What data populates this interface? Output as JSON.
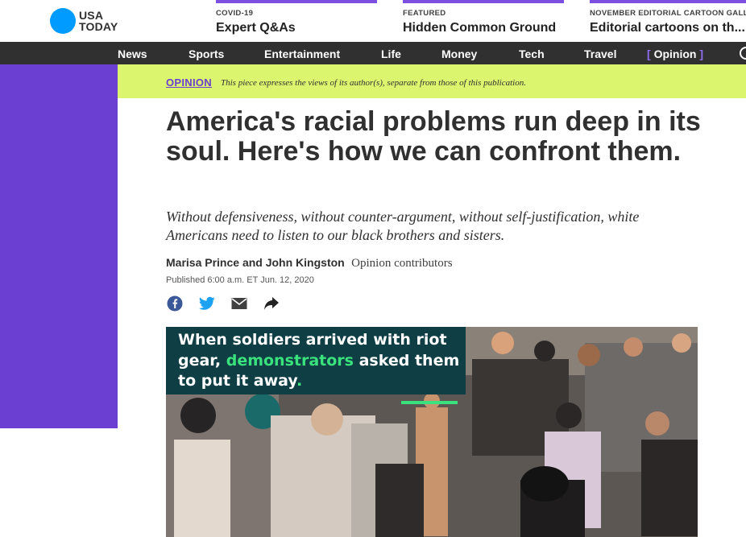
{
  "brand": {
    "logo_line1": "USA",
    "logo_line2": "TODAY"
  },
  "promos": [
    {
      "kicker": "COVID-19",
      "title": "Expert Q&As"
    },
    {
      "kicker": "FEATURED",
      "title": "Hidden Common Ground"
    },
    {
      "kicker": "NOVEMBER EDITORIAL CARTOON GALLERY",
      "title": "Editorial cartoons on th..."
    }
  ],
  "nav": {
    "items": [
      "News",
      "Sports",
      "Entertainment",
      "Life",
      "Money",
      "Tech",
      "Travel"
    ],
    "active": {
      "open": "[",
      "label": "Opinion",
      "close": "]"
    }
  },
  "banner": {
    "label": "OPINION",
    "disclaimer": "This piece expresses the views of its author(s), separate from those of this publication."
  },
  "article": {
    "headline": "America's racial problems run deep in its soul. Here's how we can confront them.",
    "dek": "Without defensiveness, without counter-argument, without self-justification, white Americans need to listen to our black brothers and sisters.",
    "authors": "Marisa Prince and John Kingston",
    "author_role": "Opinion contributors",
    "published": "Published 6:00 a.m. ET Jun. 12, 2020"
  },
  "share": [
    "facebook-icon",
    "twitter-icon",
    "email-icon",
    "share-icon"
  ],
  "hero": {
    "caption_part1": "When soldiers arrived with riot gear, ",
    "caption_highlight": "demonstrators",
    "caption_part2": " asked them to put it away",
    "caption_end": "."
  },
  "colors": {
    "brand_blue": "#009bff",
    "opinion_purple": "#6a3fd1",
    "banner_green": "#dcf56e",
    "nav_dark": "#303030",
    "caption_teal": "#0f3e45",
    "caption_accent": "#39e27c"
  }
}
